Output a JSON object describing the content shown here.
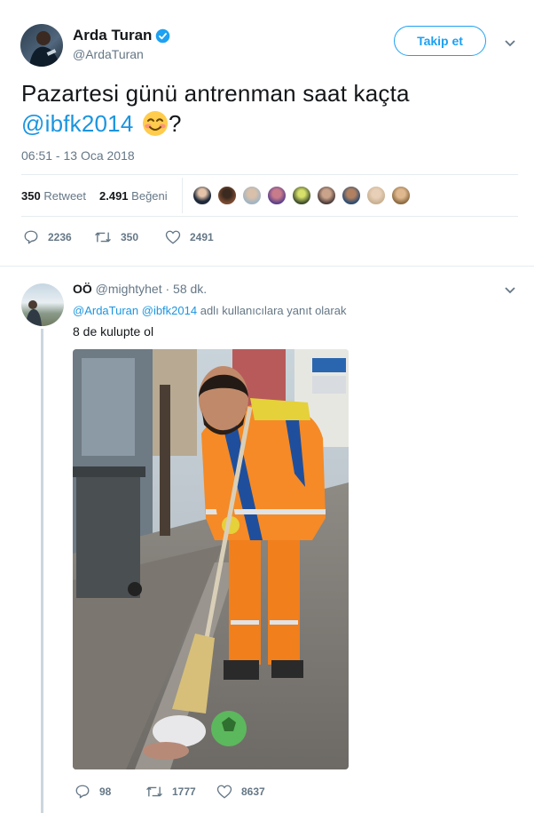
{
  "tweet": {
    "author_name": "Arda Turan",
    "author_handle": "@ArdaTuran",
    "follow_label": "Takip et",
    "text_before": "Pazartesi günü antrenman saat kaçta",
    "mention": "@ibfk2014",
    "text_after": "?",
    "timestamp": "06:51 - 13 Oca 2018",
    "retweets_count": "350",
    "retweets_label": "Retweet",
    "likes_count": "2.491",
    "likes_label": "Beğeni",
    "actions": {
      "replies": "2236",
      "retweets": "350",
      "likes": "2491"
    }
  },
  "reply": {
    "author_name": "OÖ",
    "author_handle": "@mightyhet",
    "time_ago": "· 58 dk.",
    "replying_to_mentions": "@ArdaTuran @ibfk2014",
    "replying_to_suffix": "adlı kullanıcılara yanıt olarak",
    "text": "8 de kulupte ol",
    "actions": {
      "replies": "98",
      "retweets": "1777",
      "likes": "8637"
    }
  },
  "colors": {
    "accent": "#1da1f2",
    "link": "#1b95e0",
    "muted": "#657786",
    "verified": "#1da1f2",
    "thread_line": "#ccd6dd"
  },
  "icons": [
    "verified-badge-icon",
    "chevron-down-icon",
    "reply-icon",
    "retweet-icon",
    "like-icon"
  ]
}
